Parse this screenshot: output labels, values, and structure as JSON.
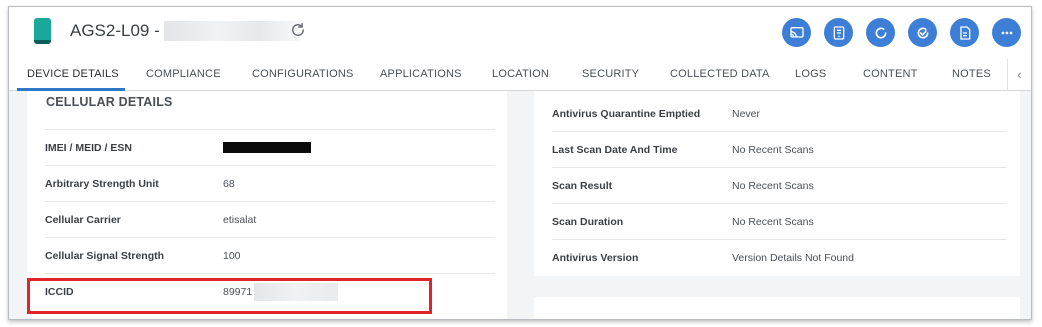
{
  "header": {
    "device_name": "AGS2-L09 -",
    "actions": [
      {
        "icon": "cast-icon"
      },
      {
        "icon": "remote-icon"
      },
      {
        "icon": "sync-icon"
      },
      {
        "icon": "check-icon"
      },
      {
        "icon": "document-icon"
      },
      {
        "icon": "more-icon"
      }
    ]
  },
  "tabs": [
    {
      "label": "DEVICE DETAILS",
      "active": true
    },
    {
      "label": "COMPLIANCE"
    },
    {
      "label": "CONFIGURATIONS"
    },
    {
      "label": "APPLICATIONS"
    },
    {
      "label": "LOCATION"
    },
    {
      "label": "SECURITY"
    },
    {
      "label": "COLLECTED DATA"
    },
    {
      "label": "LOGS"
    },
    {
      "label": "CONTENT"
    },
    {
      "label": "NOTES"
    }
  ],
  "tab_scroll_glyph": "‹",
  "cellular": {
    "title": "CELLULAR DETAILS",
    "rows": [
      {
        "label": "IMEI / MEID / ESN",
        "value": ""
      },
      {
        "label": "Arbitrary Strength Unit",
        "value": "68"
      },
      {
        "label": "Cellular Carrier",
        "value": "etisalat"
      },
      {
        "label": "Cellular Signal Strength",
        "value": "100"
      },
      {
        "label": "ICCID",
        "value": "89971"
      }
    ]
  },
  "antivirus": {
    "rows": [
      {
        "label": "Antivirus Quarantine Emptied",
        "value": "Never"
      },
      {
        "label": "Last Scan Date And Time",
        "value": "No Recent Scans"
      },
      {
        "label": "Scan Result",
        "value": "No Recent Scans"
      },
      {
        "label": "Scan Duration",
        "value": "No Recent Scans"
      },
      {
        "label": "Antivirus Version",
        "value": "Version Details Not Found"
      }
    ]
  },
  "colors": {
    "accent": "#3d7fd6",
    "tab_underline": "#2e79c7",
    "highlight": "#e0242c",
    "device_icon": "#1aa89a"
  }
}
